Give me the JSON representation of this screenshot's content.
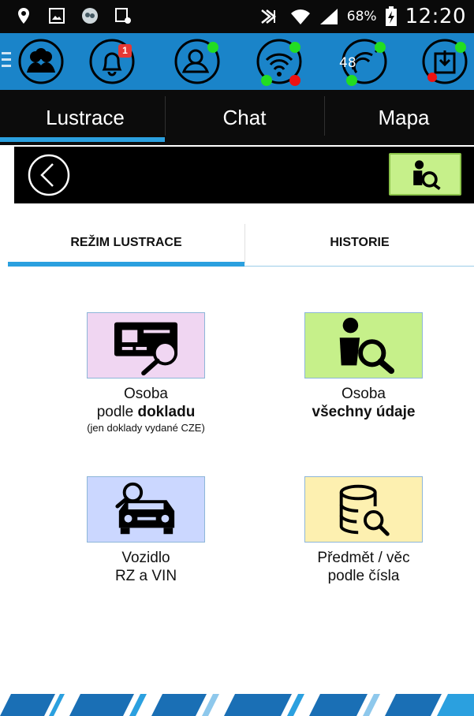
{
  "status_bar": {
    "battery_percent": "68%",
    "time": "12:20"
  },
  "toolbar": {
    "notification_count": "1",
    "signal_count": "48"
  },
  "main_tabs": [
    {
      "label": "Lustrace",
      "selected": true
    },
    {
      "label": "Chat",
      "selected": false
    },
    {
      "label": "Mapa",
      "selected": false
    }
  ],
  "sub_tabs": [
    {
      "label": "REŽIM LUSTRACE",
      "selected": true
    },
    {
      "label": "HISTORIE",
      "selected": false
    }
  ],
  "tiles": [
    {
      "line1": "Osoba",
      "line2_prefix": "podle ",
      "line2_bold": "dokladu",
      "note": "(jen doklady vydané CZE)",
      "icon": "id-card-search-icon",
      "color": "#f0d6f2"
    },
    {
      "line1": "Osoba",
      "line2_bold": "všechny údaje",
      "icon": "person-search-icon",
      "color": "#c6f08a"
    },
    {
      "line1": "Vozidlo",
      "line2": "RZ a VIN",
      "icon": "car-search-icon",
      "color": "#cbd7ff"
    },
    {
      "line1": "Předmět / věc",
      "line2": "podle čísla",
      "icon": "database-search-icon",
      "color": "#fdf0b0"
    }
  ],
  "colors": {
    "toolbar_blue": "#1a84c9",
    "accent_blue": "#2ba0df",
    "status_green": "#22dd22",
    "status_red": "#ee1111"
  }
}
